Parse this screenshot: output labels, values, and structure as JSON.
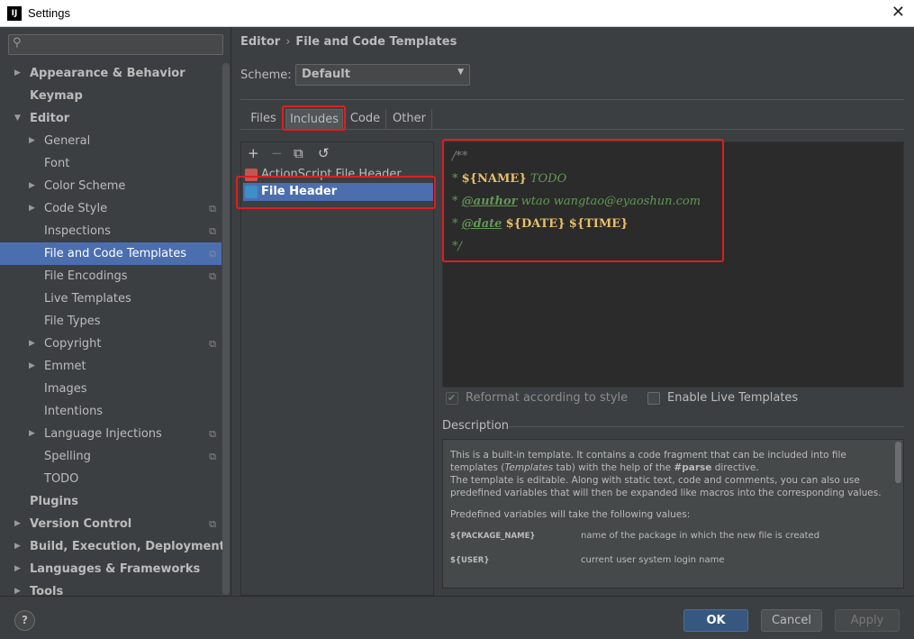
{
  "window": {
    "title": "Settings",
    "app_icon": "IJ"
  },
  "search": {
    "placeholder": ""
  },
  "tree": [
    {
      "label": "Appearance & Behavior",
      "bold": true,
      "level": 0,
      "arrow": "right"
    },
    {
      "label": "Keymap",
      "bold": true,
      "level": 0,
      "arrow": ""
    },
    {
      "label": "Editor",
      "bold": true,
      "level": 0,
      "arrow": "down"
    },
    {
      "label": "General",
      "level": 1,
      "arrow": "right"
    },
    {
      "label": "Font",
      "level": 1,
      "arrow": ""
    },
    {
      "label": "Color Scheme",
      "level": 1,
      "arrow": "right"
    },
    {
      "label": "Code Style",
      "level": 1,
      "arrow": "right",
      "copy": true
    },
    {
      "label": "Inspections",
      "level": 1,
      "arrow": "",
      "copy": true
    },
    {
      "label": "File and Code Templates",
      "level": 1,
      "arrow": "",
      "copy": true,
      "selected": true
    },
    {
      "label": "File Encodings",
      "level": 1,
      "arrow": "",
      "copy": true
    },
    {
      "label": "Live Templates",
      "level": 1,
      "arrow": ""
    },
    {
      "label": "File Types",
      "level": 1,
      "arrow": ""
    },
    {
      "label": "Copyright",
      "level": 1,
      "arrow": "right",
      "copy": true
    },
    {
      "label": "Emmet",
      "level": 1,
      "arrow": "right"
    },
    {
      "label": "Images",
      "level": 1,
      "arrow": ""
    },
    {
      "label": "Intentions",
      "level": 1,
      "arrow": ""
    },
    {
      "label": "Language Injections",
      "level": 1,
      "arrow": "right",
      "copy": true
    },
    {
      "label": "Spelling",
      "level": 1,
      "arrow": "",
      "copy": true
    },
    {
      "label": "TODO",
      "level": 1,
      "arrow": ""
    },
    {
      "label": "Plugins",
      "bold": true,
      "level": 0,
      "arrow": ""
    },
    {
      "label": "Version Control",
      "bold": true,
      "level": 0,
      "arrow": "right",
      "copy": true
    },
    {
      "label": "Build, Execution, Deployment",
      "bold": true,
      "level": 0,
      "arrow": "right"
    },
    {
      "label": "Languages & Frameworks",
      "bold": true,
      "level": 0,
      "arrow": "right"
    },
    {
      "label": "Tools",
      "bold": true,
      "level": 0,
      "arrow": "right"
    }
  ],
  "breadcrumb": {
    "part1": "Editor",
    "separator": "›",
    "part2": "File and Code Templates"
  },
  "scheme": {
    "label": "Scheme:",
    "value": "Default"
  },
  "tabs": [
    "Files",
    "Includes",
    "Code",
    "Other"
  ],
  "active_tab": "Includes",
  "toolbar": {
    "add": "+",
    "remove": "−",
    "copy": "⧉",
    "reset": "↺"
  },
  "templates": [
    {
      "name": "ActionScript File Header",
      "icon_color": "#c75450"
    },
    {
      "name": "File Header",
      "icon_color": "#3d8fc8",
      "selected": true
    }
  ],
  "code": {
    "line1": "/**",
    "line2_star": "* ",
    "line2_var": "${NAME}",
    "line2_rest": " TODO",
    "line3_star": "* ",
    "line3_tag": "@author",
    "line3_rest": " wtao wangtao@eyaoshun.com",
    "line4_star": "* ",
    "line4_tag": "@date",
    "line4_var1": "${DATE}",
    "line4_var2": "${TIME}",
    "line5": "*/"
  },
  "options": {
    "reformat": "Reformat according to style",
    "live_templates": "Enable Live Templates"
  },
  "description": {
    "title": "Description",
    "p1_a": "This is a built-in template. It contains a code fragment that can be included into file templates (",
    "p1_em": "Templates",
    "p1_b": " tab) with the help of the ",
    "p1_strong": "#parse",
    "p1_c": " directive.",
    "p2": "The template is editable. Along with static text, code and comments, you can also use predefined variables that will then be expanded like macros into the corresponding values.",
    "p3": "Predefined variables will take the following values:",
    "vars": [
      {
        "name": "${PACKAGE_NAME}",
        "meaning": "name of the package in which the new file is created"
      },
      {
        "name": "${USER}",
        "meaning": "current user system login name"
      }
    ]
  },
  "buttons": {
    "help": "?",
    "ok": "OK",
    "cancel": "Cancel",
    "apply": "Apply"
  },
  "colors": {
    "accent": "#4b6eaf",
    "highlight": "#e01e1e"
  }
}
